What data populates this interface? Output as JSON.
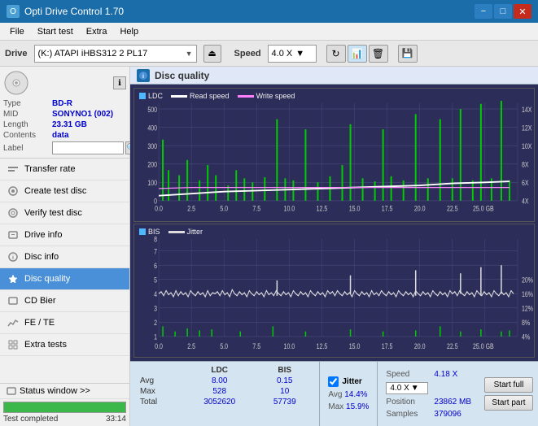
{
  "titleBar": {
    "title": "Opti Drive Control 1.70",
    "minimizeBtn": "−",
    "maximizeBtn": "□",
    "closeBtn": "✕"
  },
  "menuBar": {
    "items": [
      "File",
      "Start test",
      "Extra",
      "Help"
    ]
  },
  "driveBar": {
    "driveLabel": "Drive",
    "driveValue": "(K:) ATAPI iHBS312  2 PL17",
    "speedLabel": "Speed",
    "speedValue": "4.0 X"
  },
  "discInfo": {
    "typeLabel": "Type",
    "typeValue": "BD-R",
    "midLabel": "MID",
    "midValue": "SONYNO1 (002)",
    "lengthLabel": "Length",
    "lengthValue": "23.31 GB",
    "contentsLabel": "Contents",
    "contentsValue": "data",
    "labelLabel": "Label"
  },
  "navItems": [
    {
      "id": "transfer-rate",
      "label": "Transfer rate",
      "icon": "📊"
    },
    {
      "id": "create-test-disc",
      "label": "Create test disc",
      "icon": "💿"
    },
    {
      "id": "verify-test-disc",
      "label": "Verify test disc",
      "icon": "✓"
    },
    {
      "id": "drive-info",
      "label": "Drive info",
      "icon": "ℹ"
    },
    {
      "id": "disc-info",
      "label": "Disc info",
      "icon": "📀"
    },
    {
      "id": "disc-quality",
      "label": "Disc quality",
      "icon": "★",
      "active": true
    },
    {
      "id": "cd-bier",
      "label": "CD Bier",
      "icon": "📋"
    },
    {
      "id": "fe-te",
      "label": "FE / TE",
      "icon": "📉"
    },
    {
      "id": "extra-tests",
      "label": "Extra tests",
      "icon": "🔧"
    }
  ],
  "statusWindow": {
    "label": "Status window >>",
    "progressPercent": 100,
    "progressText": "Test completed",
    "timeText": "33:14"
  },
  "discQuality": {
    "title": "Disc quality",
    "legend": {
      "ldc": "LDC",
      "readSpeed": "Read speed",
      "writeSpeed": "Write speed",
      "bis": "BIS",
      "jitter": "Jitter"
    }
  },
  "stats": {
    "headers": [
      "LDC",
      "BIS"
    ],
    "avg": {
      "label": "Avg",
      "ldc": "8.00",
      "bis": "0.15"
    },
    "max": {
      "label": "Max",
      "ldc": "528",
      "bis": "10"
    },
    "total": {
      "label": "Total",
      "ldc": "3052620",
      "bis": "57739"
    },
    "jitterLabel": "Jitter",
    "jitterAvg": "14.4%",
    "jitterMax": "15.9%",
    "speedLabel": "Speed",
    "speedValue": "4.18 X",
    "speedSelectValue": "4.0 X",
    "positionLabel": "Position",
    "positionValue": "23862 MB",
    "samplesLabel": "Samples",
    "samplesValue": "379096",
    "startFullBtn": "Start full",
    "startPartBtn": "Start part"
  }
}
